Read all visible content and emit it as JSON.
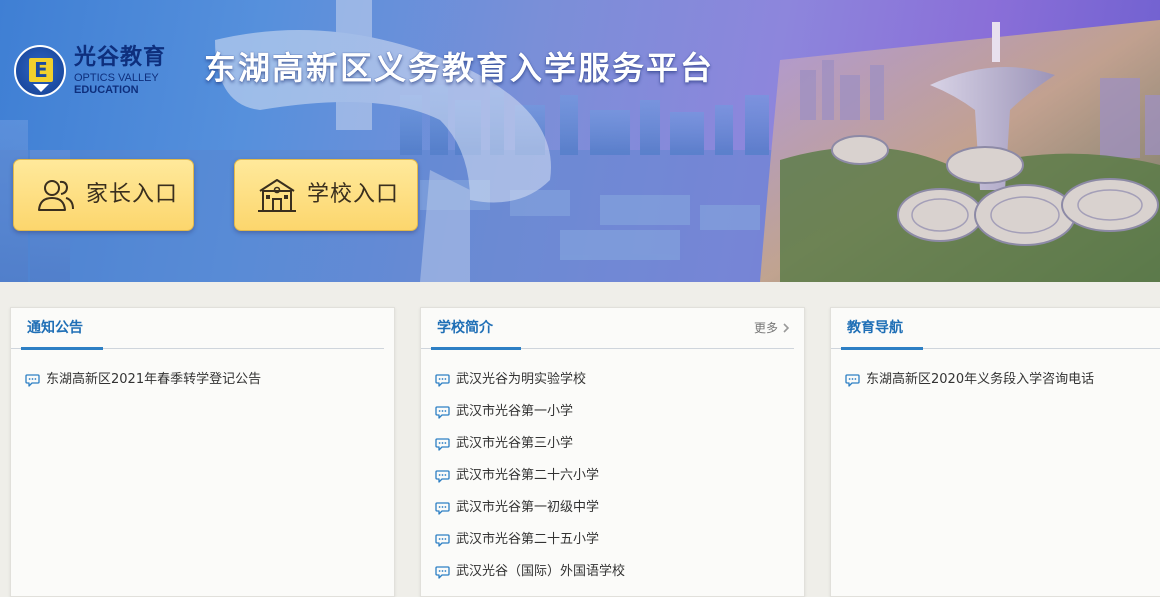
{
  "logo": {
    "name_cn": "光谷教育",
    "name_en_line1": "OPTICS VALLEY",
    "name_en_line2": "EDUCATION"
  },
  "header": {
    "title": "东湖高新区义务教育入学服务平台"
  },
  "entries": {
    "parent_label": "家长入口",
    "school_label": "学校入口"
  },
  "panels": {
    "notice": {
      "title": "通知公告",
      "items": [
        "东湖高新区2021年春季转学登记公告"
      ]
    },
    "schools": {
      "title": "学校简介",
      "more_label": "更多",
      "items": [
        "武汉光谷为明实验学校",
        "武汉市光谷第一小学",
        "武汉市光谷第三小学",
        "武汉市光谷第二十六小学",
        "武汉市光谷第一初级中学",
        "武汉市光谷第二十五小学",
        "武汉光谷（国际）外国语学校"
      ]
    },
    "nav": {
      "title": "教育导航",
      "items": [
        "东湖高新区2020年义务段入学咨询电话"
      ]
    }
  },
  "colors": {
    "accent": "#1f6fb6",
    "button_bg": "#fcd66d",
    "page_bg": "#efeee9"
  },
  "icons": {
    "parent": "users-icon",
    "school": "school-building-icon",
    "list_item": "chat-bubble-icon",
    "more": "chevron-right-icon"
  }
}
